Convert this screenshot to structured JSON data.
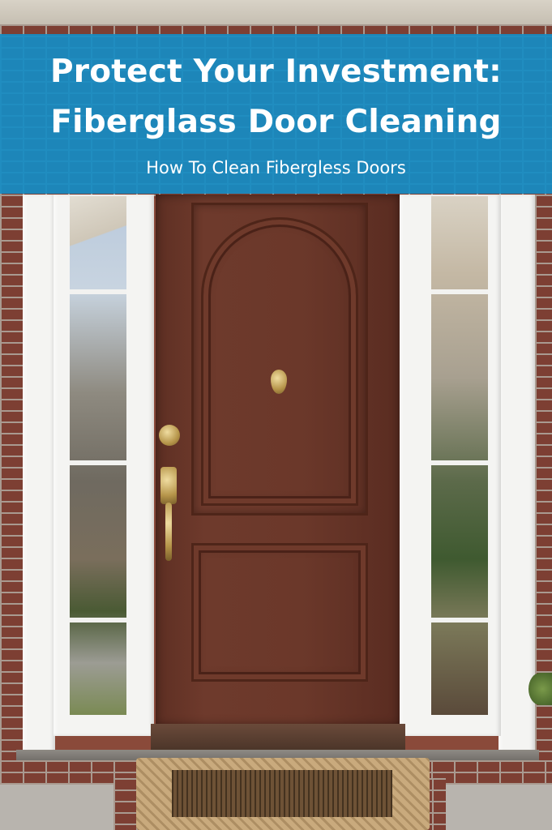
{
  "banner": {
    "title_line1": "Protect Your Investment:",
    "title_line2": "Fiberglass Door Cleaning",
    "subtitle": "How To Clean Fibergless Doors",
    "background_color": "#168cc4"
  },
  "photo": {
    "subject": "brown fiberglass front door with sidelights",
    "door_color": "#6b382a",
    "trim_color": "#f4f4f2",
    "brick_color": "#7d3f33"
  }
}
